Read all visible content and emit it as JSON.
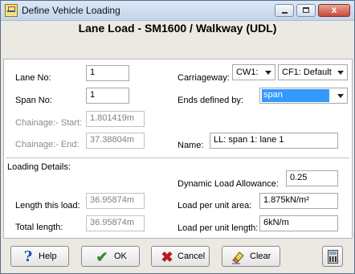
{
  "window": {
    "title": "Define Vehicle Loading",
    "close_glyph": "x"
  },
  "heading": "Lane Load - SM1600 / Walkway (UDL)",
  "fields": {
    "lane_no": {
      "label": "Lane No:",
      "value": "1"
    },
    "span_no": {
      "label": "Span No:",
      "value": "1"
    },
    "chainage_start": {
      "label": "Chainage:- Start:",
      "value": "1.801419m"
    },
    "chainage_end": {
      "label": "Chainage:- End:",
      "value": "37.38804m"
    },
    "carriageway": {
      "label": "Carriageway:",
      "value1": "CW1:",
      "value2": "CF1: Default"
    },
    "ends_defined_by": {
      "label": "Ends defined by:",
      "value": "span"
    },
    "name": {
      "label": "Name:",
      "value": "LL: span 1: lane 1"
    }
  },
  "loading": {
    "section_label": "Loading Details:",
    "length_this_load": {
      "label": "Length this load:",
      "value": "36.95874m"
    },
    "total_length": {
      "label": "Total length:",
      "value": "36.95874m"
    },
    "dynamic_load_allowance": {
      "label": "Dynamic Load Allowance:",
      "value": "0.25"
    },
    "load_per_unit_area": {
      "label": "Load per unit area:",
      "value": "1.875kN/m²"
    },
    "load_per_unit_length": {
      "label": "Load per unit length:",
      "value": "6kN/m"
    }
  },
  "buttons": {
    "help": {
      "label": "Help",
      "icon": "help-icon"
    },
    "ok": {
      "label": "OK",
      "icon": "checkmark-icon"
    },
    "cancel": {
      "label": "Cancel",
      "icon": "x-icon"
    },
    "clear": {
      "label": "Clear",
      "icon": "eraser-icon"
    },
    "calculator": {
      "icon": "calculator-icon"
    }
  },
  "colors": {
    "selection": "#3399ff",
    "ok_green": "#2e8b2e",
    "cancel_red": "#c0181b",
    "help_blue": "#1a4fb5"
  }
}
